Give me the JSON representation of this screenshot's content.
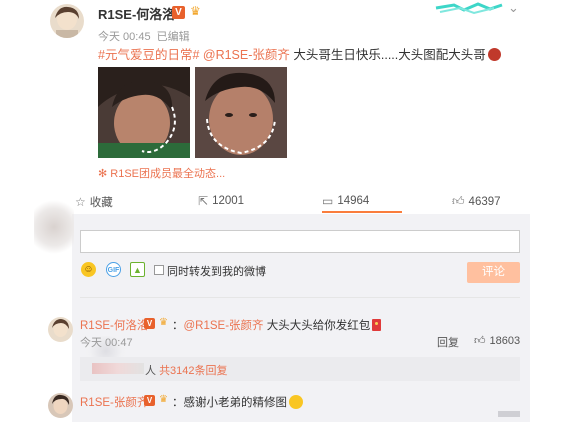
{
  "post": {
    "author": "R1SE-何洛洛",
    "vip_badge": "V",
    "time": "今天 00:45",
    "edited": "已编辑",
    "text_topic": "#元气爱豆的日常#",
    "text_mention": "@R1SE-张颜齐",
    "text_body": "大头哥生日快乐.....大头图配大头哥",
    "group_link": "R1SE团成员最全动态...",
    "chevron": "⌄"
  },
  "actions": {
    "favorite_label": "收藏",
    "forward_count": "12001",
    "comment_count": "14964",
    "like_count": "46397"
  },
  "composer": {
    "forward_checkbox_label": "同时转发到我的微博",
    "submit_label": "评论",
    "gif_label": "GIF"
  },
  "comments": [
    {
      "author": "R1SE-何洛洛",
      "prefix": "：",
      "mention": "@R1SE-张颜齐",
      "text": "大头大头给你发红包",
      "time": "今天 00:47",
      "reply_label": "回复",
      "likes": "18603",
      "reply_summary_suffix": "人",
      "reply_summary_link": "共3142条回复"
    },
    {
      "author": "R1SE-张颜齐",
      "prefix": "：",
      "text": "感谢小老弟的精修图"
    }
  ],
  "colors": {
    "link_orange": "#eb7350",
    "accent": "#fa7d3c",
    "submit_disabled": "#ffc09f"
  }
}
